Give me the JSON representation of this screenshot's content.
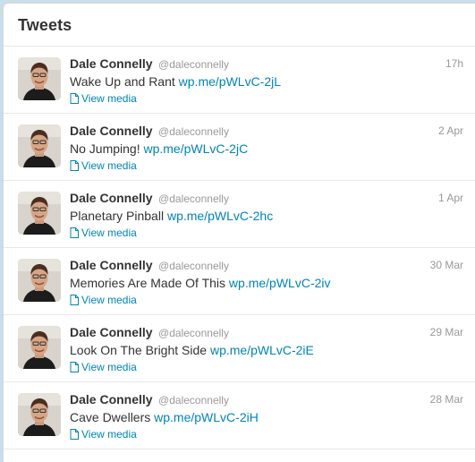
{
  "panel": {
    "title": "Tweets"
  },
  "tweets": [
    {
      "fullname": "Dale Connelly",
      "username": "@daleconnelly",
      "timestamp": "17h",
      "text": "Wake Up and Rant",
      "link": "wp.me/pWLvC-2jL",
      "media_label": "View media",
      "media_icon": "document-icon"
    },
    {
      "fullname": "Dale Connelly",
      "username": "@daleconnelly",
      "timestamp": "2 Apr",
      "text": "No Jumping!",
      "link": "wp.me/pWLvC-2jC",
      "media_label": "View media",
      "media_icon": "document-icon"
    },
    {
      "fullname": "Dale Connelly",
      "username": "@daleconnelly",
      "timestamp": "1 Apr",
      "text": "Planetary Pinball",
      "link": "wp.me/pWLvC-2hc",
      "media_label": "View media",
      "media_icon": "document-icon"
    },
    {
      "fullname": "Dale Connelly",
      "username": "@daleconnelly",
      "timestamp": "30 Mar",
      "text": "Memories Are Made Of This",
      "link": "wp.me/pWLvC-2iv",
      "media_label": "View media",
      "media_icon": "document-icon"
    },
    {
      "fullname": "Dale Connelly",
      "username": "@daleconnelly",
      "timestamp": "29 Mar",
      "text": "Look On The Bright Side",
      "link": "wp.me/pWLvC-2iE",
      "media_label": "View media",
      "media_icon": "document-icon"
    },
    {
      "fullname": "Dale Connelly",
      "username": "@daleconnelly",
      "timestamp": "28 Mar",
      "text": "Cave Dwellers",
      "link": "wp.me/pWLvC-2iH",
      "media_label": "View media",
      "media_icon": "document-icon"
    }
  ],
  "colors": {
    "background": "#c8dfe9",
    "link": "#0084b4",
    "text": "#333333",
    "muted": "#999999"
  }
}
